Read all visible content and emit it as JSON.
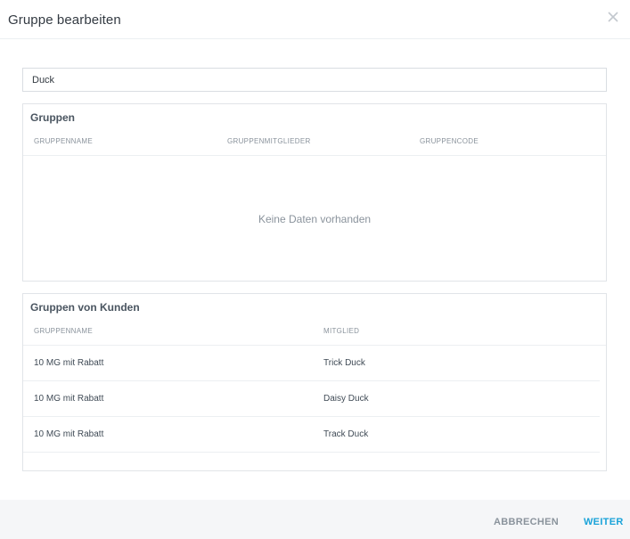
{
  "dialog": {
    "title": "Gruppe bearbeiten",
    "close_icon": "close-icon"
  },
  "search": {
    "value": "Duck",
    "placeholder": ""
  },
  "groups": {
    "title": "Gruppen",
    "columns": [
      "GRUPPENNAME",
      "GRUPPENMITGLIEDER",
      "GRUPPENCODE"
    ],
    "empty_text": "Keine Daten vorhanden"
  },
  "customer_groups": {
    "title": "Gruppen von Kunden",
    "columns": [
      "GRUPPENNAME",
      "MITGLIED"
    ],
    "rows": [
      {
        "group": "10 MG mit Rabatt",
        "member": "Trick Duck"
      },
      {
        "group": "10 MG mit Rabatt",
        "member": "Daisy Duck"
      },
      {
        "group": "10 MG mit Rabatt",
        "member": "Track Duck"
      }
    ]
  },
  "footer": {
    "cancel_label": "ABBRECHEN",
    "next_label": "WEITER"
  },
  "colors": {
    "accent": "#1aa3d9",
    "muted": "#8a939c",
    "footer_bg": "#f5f6f8"
  }
}
